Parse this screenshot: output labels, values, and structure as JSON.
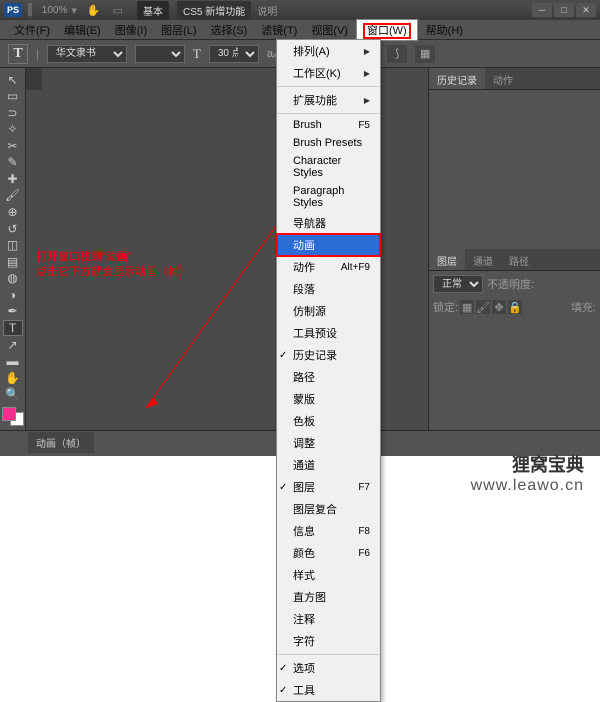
{
  "title": {
    "ps": "PS",
    "zoom": "100%",
    "ws_basic": "基本",
    "ws_ext": "CS5 新增功能",
    "ws_label": "说明"
  },
  "menubar": [
    "文件(F)",
    "编辑(E)",
    "图像(I)",
    "图层(L)",
    "选择(S)",
    "滤镜(T)",
    "视图(V)",
    "窗口(W)",
    "帮助(H)"
  ],
  "optbar": {
    "t": "T",
    "font": "华文隶书",
    "size_icon": "T",
    "size": "30 点",
    "align": "≡"
  },
  "doc_tab": "",
  "anno_line1": "打开窗口找到\"动画\"",
  "anno_line2": "点击它下方就会显示动画（帧）",
  "bottom_tab": "动画（帧）",
  "panel_history": "历史记录",
  "panel_actions": "动作",
  "panel_layers": "图层",
  "panel_channels": "通道",
  "panel_paths": "路径",
  "layer_mode": "正常",
  "layer_opacity": "不透明度:",
  "layer_lock": "锁定:",
  "layer_fill": "填充:",
  "dropdown": [
    {
      "t": "排列(A)",
      "sub": true
    },
    {
      "t": "工作区(K)",
      "sub": true
    },
    {
      "sep": true
    },
    {
      "t": "扩展功能",
      "sub": true
    },
    {
      "sep": true
    },
    {
      "t": "Brush",
      "sc": "F5"
    },
    {
      "t": "Brush Presets"
    },
    {
      "t": "Character Styles"
    },
    {
      "t": "Paragraph Styles"
    },
    {
      "t": "导航器"
    },
    {
      "t": "动画",
      "hl": true
    },
    {
      "t": "动作",
      "sc": "Alt+F9"
    },
    {
      "t": "段落"
    },
    {
      "t": "仿制源"
    },
    {
      "t": "工具预设"
    },
    {
      "t": "历史记录",
      "chk": true
    },
    {
      "t": "路径"
    },
    {
      "t": "蒙版"
    },
    {
      "t": "色板"
    },
    {
      "t": "调整"
    },
    {
      "t": "通道"
    },
    {
      "t": "图层",
      "sc": "F7",
      "chk": true
    },
    {
      "t": "图层复合"
    },
    {
      "t": "信息",
      "sc": "F8"
    },
    {
      "t": "颜色",
      "sc": "F6"
    },
    {
      "t": "样式"
    },
    {
      "t": "直方图"
    },
    {
      "t": "注释"
    },
    {
      "t": "字符"
    },
    {
      "sep": true
    },
    {
      "t": "选项",
      "chk": true
    },
    {
      "t": "工具",
      "chk": true
    }
  ],
  "colors": {
    "accent": "#ff2b8f",
    "fg": "#ff2b8f"
  },
  "watermark": {
    "zh": "狸窝宝典",
    "en": "www.leawo.cn"
  }
}
